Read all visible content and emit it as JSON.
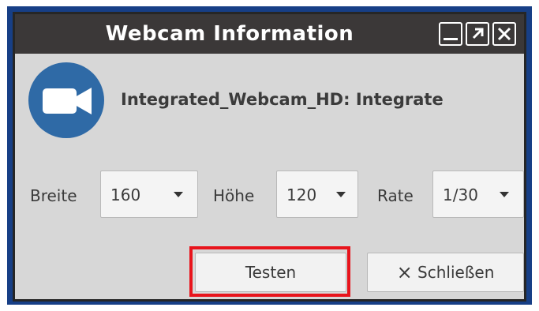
{
  "window": {
    "title": "Webcam Information",
    "controls": {
      "minimize": "minimize",
      "maximize": "maximize",
      "close": "close"
    }
  },
  "device": {
    "icon": "video-camera-icon",
    "name": "Integrated_Webcam_HD: Integrate"
  },
  "settings": {
    "width": {
      "label": "Breite",
      "value": "160"
    },
    "height": {
      "label": "Höhe",
      "value": "120"
    },
    "rate": {
      "label": "Rate",
      "value": "1/30"
    }
  },
  "buttons": {
    "test_label": "Testen",
    "close_label": "Schließen",
    "close_icon": "×"
  },
  "colors": {
    "accent_blue": "#2f6aa6",
    "titlebar": "#3b3838",
    "frame": "#173f86",
    "highlight": "#e8141c"
  }
}
